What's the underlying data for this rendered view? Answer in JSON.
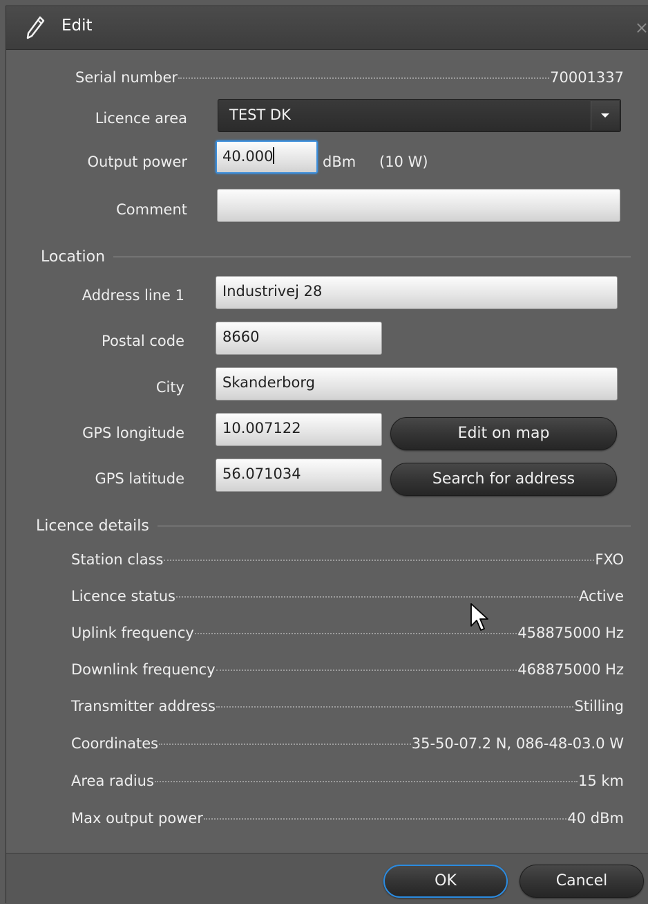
{
  "window": {
    "title": "Edit",
    "close_glyph": "×"
  },
  "icons": {
    "title": "pencil-icon",
    "dropdown": "chevron-down-icon",
    "close": "close-icon",
    "cursor": "mouse-pointer-icon"
  },
  "fields": {
    "serial_label": "Serial number",
    "serial_value": "70001337",
    "licence_area_label": "Licence area",
    "licence_area_value": "TEST DK",
    "output_power_label": "Output power",
    "output_power_value": "40.000",
    "output_power_unit": "dBm",
    "output_power_watts": "(10 W)",
    "comment_label": "Comment",
    "comment_value": ""
  },
  "location": {
    "title": "Location",
    "address_label": "Address line 1",
    "address_value": "Industrivej 28",
    "postal_label": "Postal code",
    "postal_value": "8660",
    "city_label": "City",
    "city_value": "Skanderborg",
    "lon_label": "GPS longitude",
    "lon_value": "10.007122",
    "lat_label": "GPS latitude",
    "lat_value": "56.071034",
    "edit_map_button": "Edit on map",
    "search_address_button": "Search for address"
  },
  "licence": {
    "title": "Licence details",
    "items": [
      {
        "key": "Station class",
        "value": "FXO"
      },
      {
        "key": "Licence status",
        "value": "Active"
      },
      {
        "key": "Uplink frequency",
        "value": "458875000 Hz"
      },
      {
        "key": "Downlink frequency",
        "value": "468875000 Hz"
      },
      {
        "key": "Transmitter address",
        "value": "Stilling"
      },
      {
        "key": "Coordinates",
        "value": "35-50-07.2 N, 086-48-03.0 W"
      },
      {
        "key": "Area radius",
        "value": "15 km"
      },
      {
        "key": "Max output power",
        "value": "40 dBm"
      }
    ]
  },
  "footer": {
    "ok": "OK",
    "cancel": "Cancel"
  },
  "colors": {
    "accent": "#3b8edb",
    "background": "#5f5f5f",
    "titlebar": "#444444"
  }
}
